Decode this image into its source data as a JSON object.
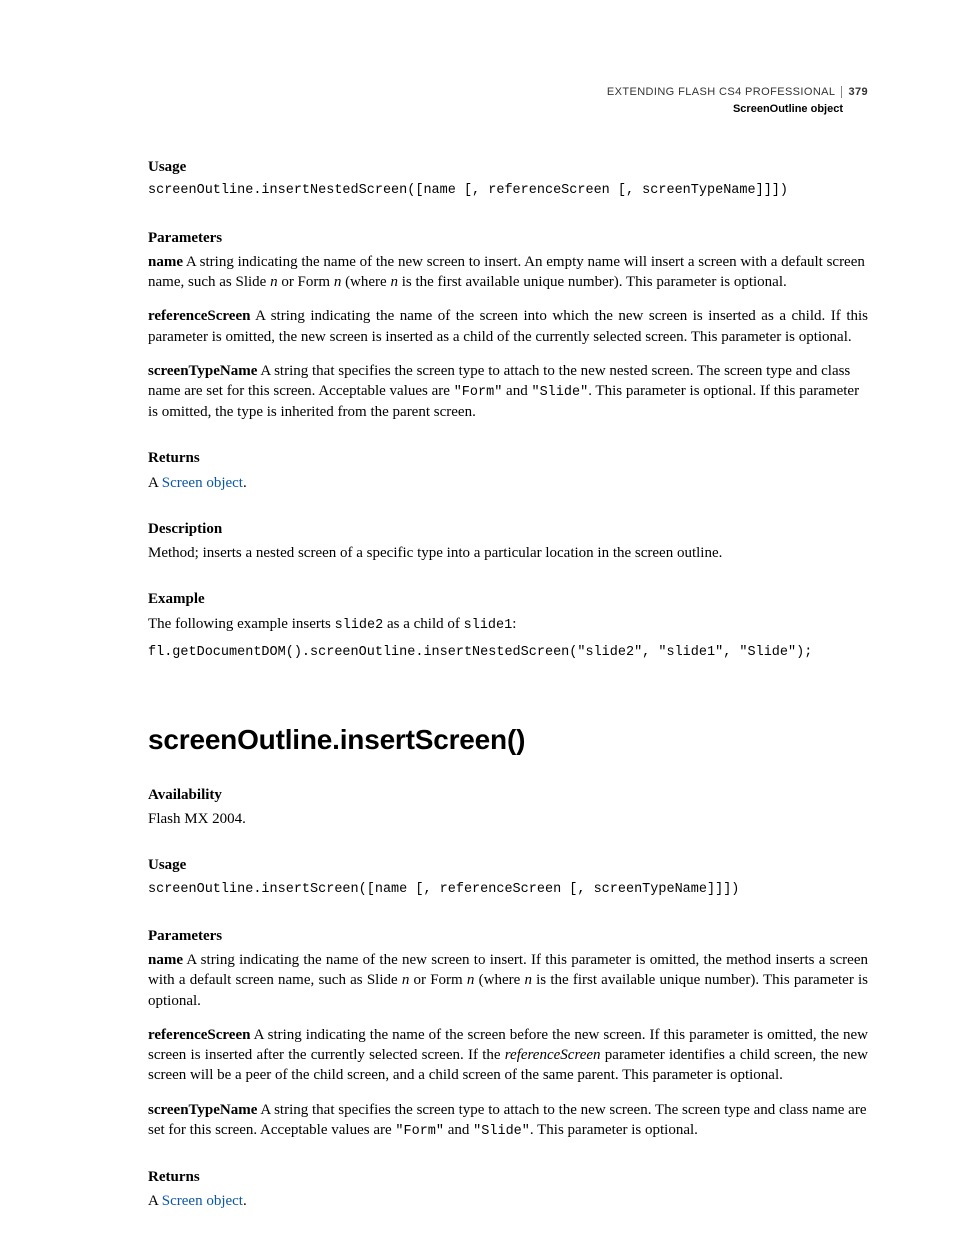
{
  "header": {
    "book_title": "EXTENDING FLASH CS4 PROFESSIONAL",
    "page_number": "379",
    "section_title": "ScreenOutline object"
  },
  "sec1": {
    "usage_h": "Usage",
    "usage_code": "screenOutline.insertNestedScreen([name [, referenceScreen [, screenTypeName]]])",
    "params_h": "Parameters",
    "p_name_bold": "name",
    "p_name_t1": "   A string indicating the name of the new screen to insert. An empty name will insert a screen with a default screen name, such as Slide ",
    "p_name_n1": "n",
    "p_name_t2": " or Form ",
    "p_name_n2": "n",
    "p_name_t3": " (where ",
    "p_name_n3": "n",
    "p_name_t4": " is the first available unique number). This parameter is optional.",
    "p_ref_bold": "referenceScreen",
    "p_ref_t": "   A string indicating the name of the screen into which the new screen is inserted as a child. If this parameter is omitted, the new screen is inserted as a child of the currently selected screen. This parameter is optional.",
    "p_stn_bold": "screenTypeName",
    "p_stn_t1": "   A string that specifies the screen type to attach to the new nested screen. The screen type and class name are set for this screen. Acceptable values are ",
    "p_stn_c1": "\"Form\"",
    "p_stn_t2": " and ",
    "p_stn_c2": "\"Slide\"",
    "p_stn_t3": ". This parameter is optional. If this parameter is omitted, the type is inherited from the parent screen.",
    "returns_h": "Returns",
    "returns_a": "A ",
    "returns_link": "Screen object",
    "returns_dot": ".",
    "desc_h": "Description",
    "desc_t": "Method; inserts a nested screen of a specific type into a particular location in the screen outline.",
    "ex_h": "Example",
    "ex_t1": "The following example inserts ",
    "ex_c1": "slide2",
    "ex_t2": " as a child of ",
    "ex_c2": "slide1",
    "ex_t3": ":",
    "ex_code": "fl.getDocumentDOM().screenOutline.insertNestedScreen(\"slide2\", \"slide1\", \"Slide\");"
  },
  "sec2": {
    "title": "screenOutline.insertScreen()",
    "avail_h": "Availability",
    "avail_t": "Flash MX 2004.",
    "usage_h": "Usage",
    "usage_code": "screenOutline.insertScreen([name [, referenceScreen [, screenTypeName]]])",
    "params_h": "Parameters",
    "p_name_bold": "name",
    "p_name_t1": "   A string indicating the name of the new screen to insert. If this parameter is omitted, the method inserts a screen with a default screen name, such as Slide ",
    "p_name_n1": "n",
    "p_name_t2": " or Form ",
    "p_name_n2": "n",
    "p_name_t3": " (where ",
    "p_name_n3": "n",
    "p_name_t4": " is the first available unique number). This parameter is optional.",
    "p_ref_bold": "referenceScreen",
    "p_ref_t1": "   A string indicating the name of the screen before the new screen. If this parameter is omitted, the new screen is inserted after the currently selected screen. If the ",
    "p_ref_i": "referenceScreen",
    "p_ref_t2": " parameter identifies a child screen, the new screen will be a peer of the child screen, and a child screen of the same parent. This parameter is optional.",
    "p_stn_bold": "screenTypeName",
    "p_stn_t1": "   A string that specifies the screen type to attach to the new screen. The screen type and class name are set for this screen. Acceptable values are ",
    "p_stn_c1": "\"Form\"",
    "p_stn_t2": " and ",
    "p_stn_c2": "\"Slide\"",
    "p_stn_t3": ". This parameter is optional.",
    "returns_h": "Returns",
    "returns_a": "A ",
    "returns_link": "Screen object",
    "returns_dot": "."
  }
}
